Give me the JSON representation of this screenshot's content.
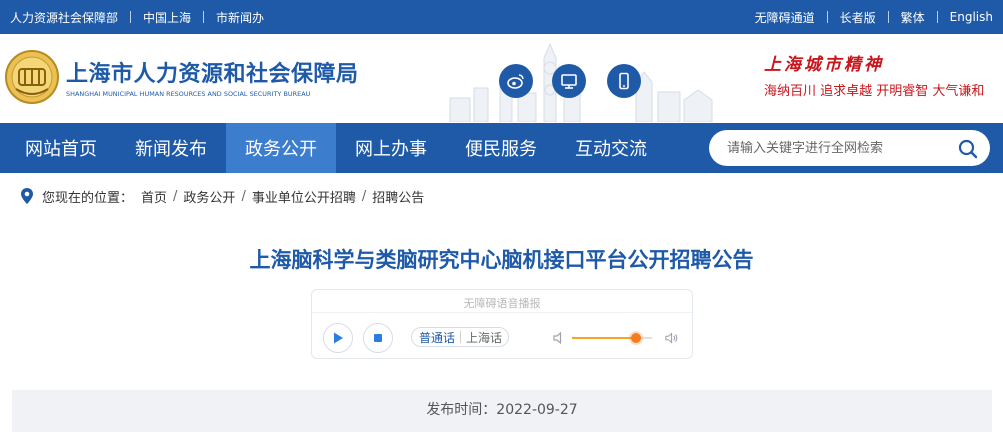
{
  "topbar": {
    "left_links": [
      "人力资源社会保障部",
      "中国上海",
      "市新闻办"
    ],
    "right_links": [
      "无障碍通道",
      "长者版",
      "繁体",
      "English"
    ]
  },
  "header": {
    "title_cn": "上海市人力资源和社会保障局",
    "title_en": "SHANGHAI MUNICIPAL HUMAN RESOURCES AND SOCIAL SECURITY BUREAU",
    "social_icons": [
      "weibo-icon",
      "monitor-icon",
      "mobile-icon"
    ],
    "spirit_title": "上海城市精神",
    "spirit_words": "海纳百川  追求卓越  开明睿智  大气谦和",
    "brand_color": "#1e5aa8",
    "accent_red": "#c8161d"
  },
  "nav": {
    "items": [
      "网站首页",
      "新闻发布",
      "政务公开",
      "网上办事",
      "便民服务",
      "互动交流"
    ],
    "active": "政务公开",
    "search_placeholder": "请输入关键字进行全网检索"
  },
  "breadcrumb": {
    "label": "您现在的位置：",
    "items": [
      "首页",
      "政务公开",
      "事业单位公开招聘",
      "招聘公告"
    ]
  },
  "article": {
    "title": "上海脑科学与类脑研究中心脑机接口平台公开招聘公告",
    "publish": "发布时间：2022-09-27"
  },
  "player": {
    "label": "无障碍语音播报",
    "lang_1": "普通话",
    "lang_2": "上海话",
    "volume": 0.8
  }
}
